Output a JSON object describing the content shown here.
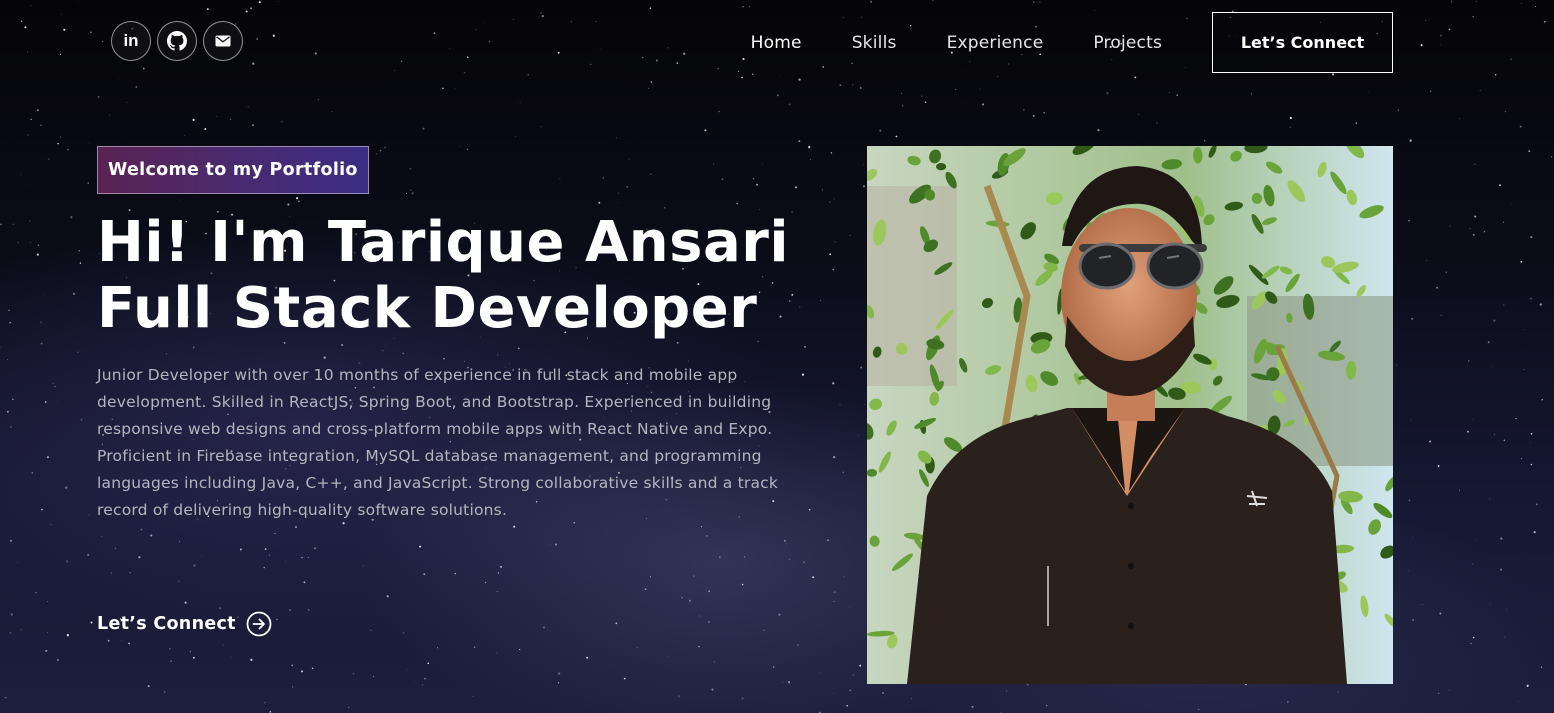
{
  "social_links": [
    {
      "name": "linkedin",
      "icon": "linkedin-icon",
      "glyph": "in"
    },
    {
      "name": "github",
      "icon": "github-icon"
    },
    {
      "name": "email",
      "icon": "mail-icon"
    }
  ],
  "nav": {
    "items": [
      {
        "label": "Home",
        "active": true
      },
      {
        "label": "Skills",
        "active": false
      },
      {
        "label": "Experience",
        "active": false
      },
      {
        "label": "Projects",
        "active": false
      }
    ],
    "cta_label": "Let’s Connect"
  },
  "hero": {
    "tagline": "Welcome to my Portfolio",
    "headline_line1": "Hi! I'm Tarique Ansari",
    "headline_line2": "Full Stack Developer",
    "bio": "Junior Developer with over 10 months of experience in full stack and mobile app development. Skilled in ReactJS, Spring Boot, and Bootstrap. Experienced in building responsive web designs and cross-platform mobile apps with React Native and Expo. Proficient in Firebase integration, MySQL database management, and programming languages including Java, C++, and JavaScript. Strong collaborative skills and a track record of delivering high-quality software solutions.",
    "cta_label": "Let’s Connect",
    "cta_icon": "arrow-right-circle-icon"
  },
  "colors": {
    "background": "#0b0c18",
    "tagline_gradient_start": "#5a2352",
    "tagline_gradient_end": "#3b2d85",
    "text_primary": "#ffffff",
    "text_secondary": "#b5b5bf"
  }
}
